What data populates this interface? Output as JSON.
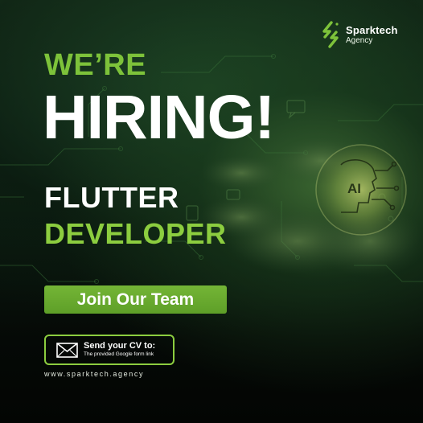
{
  "brand": {
    "name": "Sparktech",
    "sub": "Agency",
    "logo_icon": "lightning-s-icon"
  },
  "headline": {
    "line1": "WE’RE",
    "line2": "HIRING!"
  },
  "role": {
    "line1": "FLUTTER",
    "line2": "DEVELOPER"
  },
  "cta": {
    "label": "Join Our Team"
  },
  "cv": {
    "title": "Send your CV to:",
    "subtitle": "The provided Google form link",
    "icon": "mail-icon"
  },
  "website": "www.sparktech.agency",
  "chip": {
    "label": "AI",
    "icon": "ai-head-icon"
  },
  "colors": {
    "accent_green": "#7dc23a",
    "button_green": "#6aab30",
    "text_white": "#ffffff",
    "background_dark": "#050a06"
  }
}
